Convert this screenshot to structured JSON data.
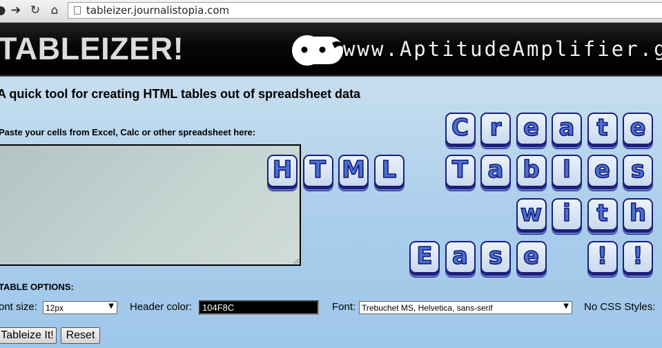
{
  "browser": {
    "back_icon": "back-arrow-icon",
    "forward_glyph": "➔",
    "reload_glyph": "↻",
    "home_glyph": "⌂",
    "url": "tableizer.journalistopia.com"
  },
  "banner": {
    "title": "TABLEIZER!",
    "site_url": "www.AptitudeAmplifier.ga"
  },
  "main": {
    "tagline": "A quick tool for creating HTML tables out of spreadsheet data",
    "paste_label": "Paste your cells from Excel, Calc or other spreadsheet here:",
    "paste_value": ""
  },
  "graphic": {
    "rows": [
      [
        "C",
        "r",
        "e",
        "a",
        "t",
        "e"
      ],
      [
        "H",
        "T",
        "M",
        "L",
        " ",
        "T",
        "a",
        "b",
        "l",
        "e",
        "s"
      ],
      [
        "w",
        "i",
        "t",
        "h"
      ],
      [
        "E",
        "a",
        "s",
        "e",
        " ",
        "!",
        "!"
      ]
    ]
  },
  "options": {
    "heading": "TABLE OPTIONS:",
    "font_size_label": "ont size:",
    "font_size_value": "12px",
    "header_color_label": "Header color:",
    "header_color_value": "104F8C",
    "font_label": "Font:",
    "font_value": "Trebuchet MS, Helvetica, sans-serif",
    "no_css_label": "No CSS Styles:"
  },
  "buttons": {
    "tableize": "Tableize It!",
    "reset": "Reset"
  },
  "colors": {
    "key_border": "#1a1f7a",
    "key_letter": "#4b6fd4",
    "banner_bg": "#000000"
  }
}
